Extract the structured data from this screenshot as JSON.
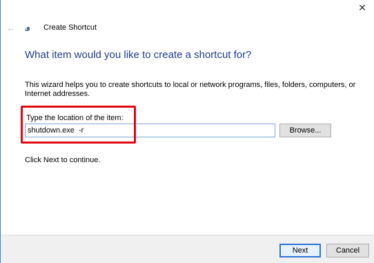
{
  "window": {
    "close_glyph": "✕",
    "header_title": "Create Shortcut",
    "back_glyph": "←"
  },
  "main": {
    "heading": "What item would you like to create a shortcut for?",
    "description": "This wizard helps you to create shortcuts to local or network programs, files, folders, computers, or Internet addresses.",
    "location_label": "Type the location of the item:",
    "location_value": "shutdown.exe  -r",
    "browse_label": "Browse...",
    "continue_text": "Click Next to continue."
  },
  "footer": {
    "next_label": "Next",
    "cancel_label": "Cancel"
  },
  "colors": {
    "heading": "#1f3d8a",
    "highlight": "#e30613",
    "accent": "#2b74d4"
  }
}
